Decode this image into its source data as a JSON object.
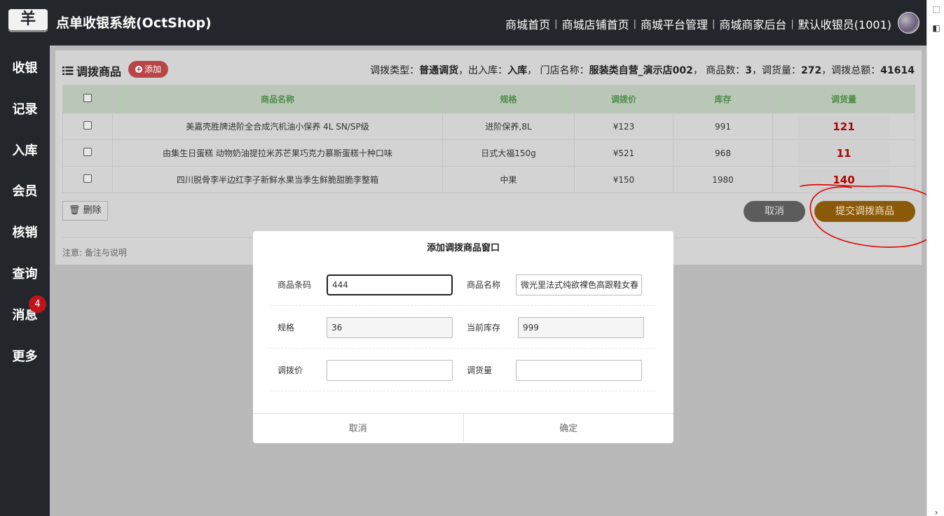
{
  "header": {
    "logo_symbol": "羊",
    "app_title": "点单收银系统(OctShop)",
    "nav": [
      "商城首页",
      "商城店铺首页",
      "商城平台管理",
      "商城商家后台",
      "默认收银员(1001)"
    ]
  },
  "sidebar": {
    "items": [
      {
        "label": "收银"
      },
      {
        "label": "记录"
      },
      {
        "label": "入库"
      },
      {
        "label": "会员"
      },
      {
        "label": "核销"
      },
      {
        "label": "查询"
      },
      {
        "label": "消息",
        "badge": "4"
      },
      {
        "label": "更多"
      }
    ]
  },
  "panel": {
    "title": "调拨商品",
    "add_label": "添加",
    "summary": {
      "type_label": "调拨类型：",
      "type_value": "普通调货",
      "io_label": "，出入库：",
      "io_value": "入库",
      "store_label": "，  门店名称：",
      "store_value": "服装类自营_演示店002",
      "count_label": "，  商品数：",
      "count_value": "3",
      "qty_label": "，调货量：",
      "qty_value": "272",
      "amount_label": "，调拨总额：",
      "amount_value": "41614"
    },
    "columns": [
      "商品名称",
      "规格",
      "调拨价",
      "库存",
      "调货量"
    ],
    "rows": [
      {
        "name": "美嘉壳胜牌进阶全合成汽机油小保养 4L SN/SP级",
        "spec": "进阶保养,8L",
        "price": "¥123",
        "stock": "991",
        "qty": "121"
      },
      {
        "name": "由集生日蛋糕 动物奶油提拉米苏芒果巧克力慕斯蛋糕十种口味",
        "spec": "日式大福150g",
        "price": "¥521",
        "stock": "968",
        "qty": "11"
      },
      {
        "name": "四川脱骨李半边红李子新鲜水果当季生鲜脆甜脆李整箱",
        "spec": "中果",
        "price": "¥150",
        "stock": "1980",
        "qty": "140"
      }
    ],
    "delete_label": "删除",
    "cancel_label": "取消",
    "submit_label": "提交调拨商品",
    "note": "注意: 备注与说明"
  },
  "dialog": {
    "title": "添加调拨商品窗口",
    "barcode_label": "商品条码",
    "barcode_value": "444",
    "name_label": "商品名称",
    "name_value": "微光里法式纯欲裸色高跟鞋女春",
    "spec_label": "规格",
    "spec_value": "36",
    "stock_label": "当前库存",
    "stock_value": "999",
    "price_label": "调拨价",
    "price_value": "",
    "qty_label": "调货量",
    "qty_value": "",
    "cancel_label": "取消",
    "ok_label": "确定"
  },
  "colors": {
    "topbar": "#23262b",
    "add_button": "#b94646",
    "submit_button": "#8a5a0a",
    "qty_text": "#b40000",
    "header_green": "#4f8a4b",
    "annotation_red": "#e00000"
  }
}
